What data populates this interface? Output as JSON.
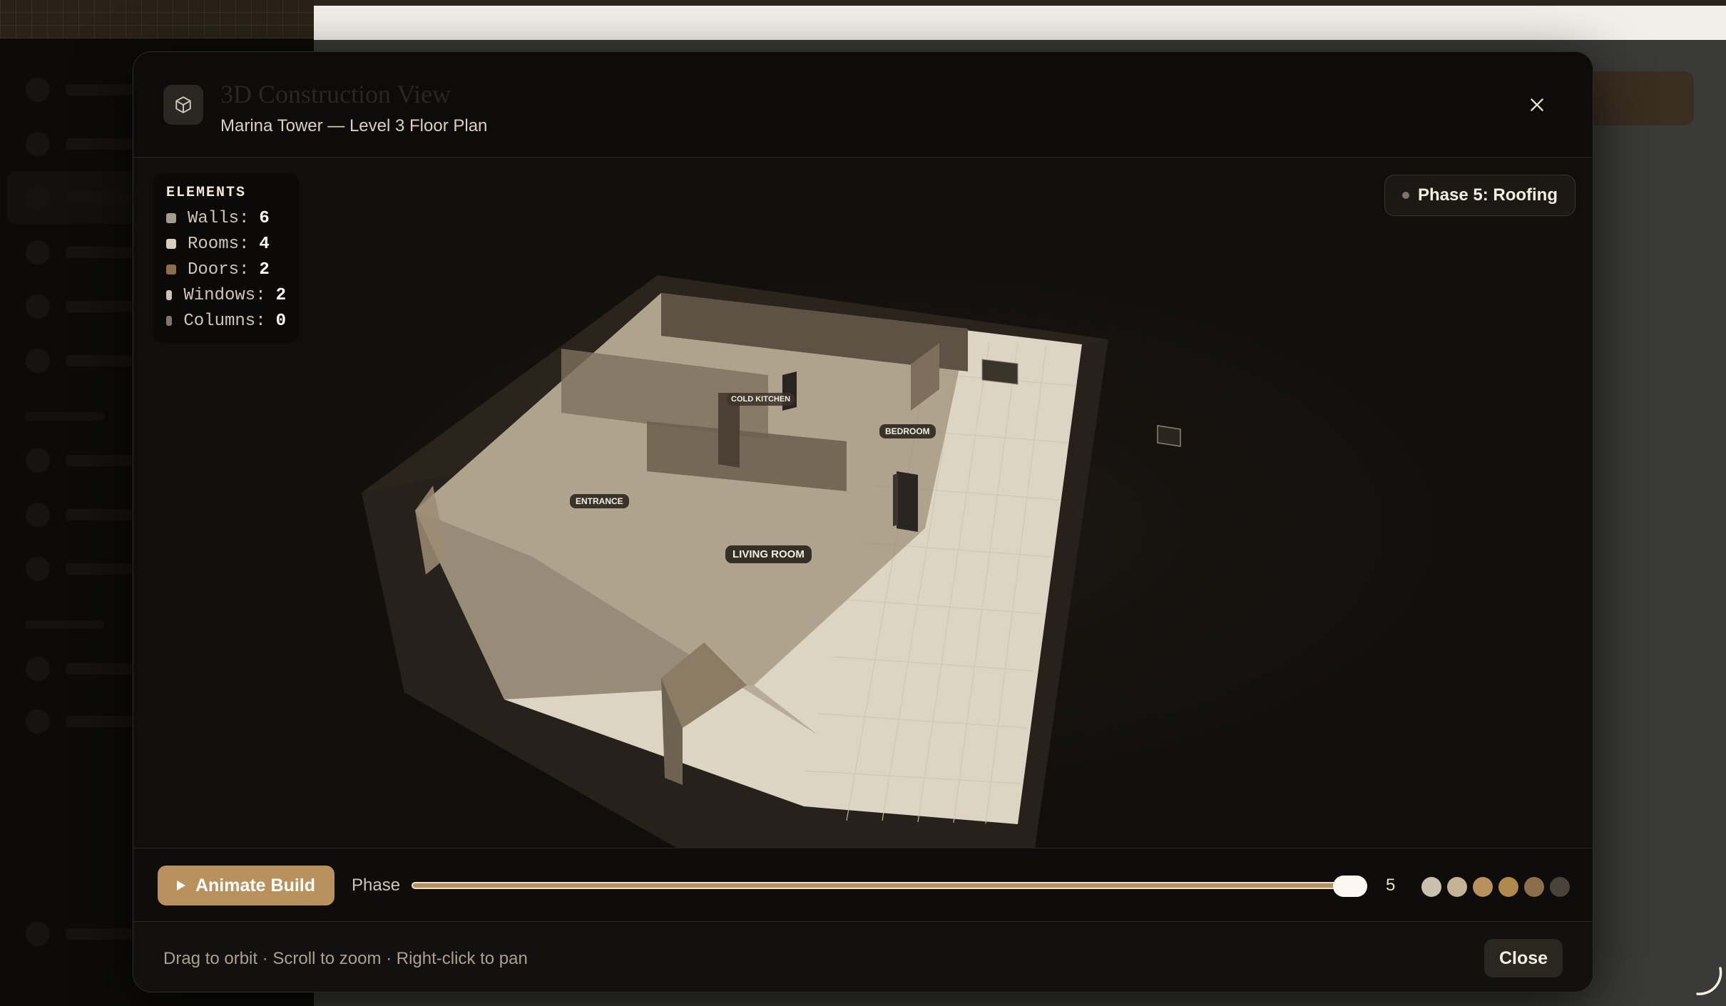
{
  "modal": {
    "title": "3D Construction View",
    "subtitle": "Marina Tower — Level 3 Floor Plan",
    "close_icon": "close-icon",
    "header_icon": "cube-icon"
  },
  "elements_panel": {
    "title": "ELEMENTS",
    "items": [
      {
        "label": "Walls:",
        "count": "6",
        "color": "#a39b8e"
      },
      {
        "label": "Rooms:",
        "count": "4",
        "color": "#d8cfbe"
      },
      {
        "label": "Doors:",
        "count": "2",
        "color": "#8c6e4a"
      },
      {
        "label": "Windows:",
        "count": "2",
        "color": "#c9c3b8"
      },
      {
        "label": "Columns:",
        "count": "0",
        "color": "#7d766c"
      }
    ]
  },
  "phase_badge": {
    "text": "Phase 5: Roofing"
  },
  "room_labels": {
    "cold_kitchen": "COLD KITCHEN",
    "bedroom": "BEDROOM",
    "entrance": "ENTRANCE",
    "living_room": "LIVING ROOM"
  },
  "controls": {
    "animate_label": "Animate Build",
    "phase_label": "Phase",
    "phase_value": "5",
    "phase_max": 5,
    "phase_dot_colors": [
      "#c9c0b0",
      "#c4b294",
      "#b8915c",
      "#b0894c",
      "#8c6e4a",
      "#4a4339"
    ]
  },
  "footer": {
    "hint": "Drag to orbit · Scroll to zoom · Right-click to pan",
    "close_label": "Close"
  },
  "colors": {
    "accent": "#b8915c",
    "modal_bg": "#0f0e0c",
    "floor_light": "#ddd5c3"
  }
}
